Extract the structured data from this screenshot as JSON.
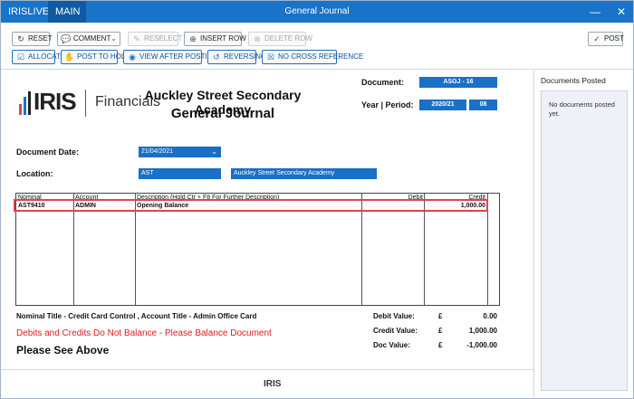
{
  "titlebar": {
    "tabs": [
      "IRISLIVE",
      "MAIN"
    ],
    "title": "General Journal",
    "minimize": "—",
    "close": "✕"
  },
  "toolbar": {
    "reset": "RESET",
    "comment": "COMMENT",
    "reselect": "RESELECT",
    "insert_row": "INSERT ROW",
    "delete_row": "DELETE ROW",
    "post": "POST",
    "allocate": "ALLOCATE",
    "post_to_hold": "POST TO HOLD",
    "view_after_posting": "VIEW AFTER POSTING",
    "reversing": "REVERSING",
    "no_cross_reference": "NO CROSS REFERENCE"
  },
  "header": {
    "logo_text": "IRIS",
    "logo_product": "Financials",
    "school_name": "Auckley Street Secondary Academy",
    "journal_title": "General Journal",
    "document_label": "Document:",
    "document_value": "ASGJ - 16",
    "year_period_label": "Year | Period:",
    "year_value": "2020/21",
    "period_value": "08"
  },
  "form": {
    "document_date_label": "Document Date:",
    "document_date_value": "21/04/2021",
    "location_label": "Location:",
    "location_code": "AST",
    "location_name": "Auckley Street Secondary Academy"
  },
  "grid": {
    "columns": [
      "Nominal",
      "Account",
      "Description (Hold Ctr + F8 For Further Description)",
      "Debit",
      "Credit"
    ],
    "rows": [
      {
        "nominal": "AST9410",
        "account": "ADMIN",
        "description": "Opening Balance",
        "debit": "",
        "credit": "1,000.00"
      }
    ]
  },
  "footer_info": {
    "nominal_title": "Nominal Title - Credit Card Control , Account Title - Admin Office Card",
    "warning": "Debits and Credits Do Not Balance - Please Balance Document",
    "see_above": "Please See Above"
  },
  "totals": {
    "currency": "£",
    "debit_label": "Debit Value:",
    "debit_value": "0.00",
    "credit_label": "Credit Value:",
    "credit_value": "1,000.00",
    "doc_label": "Doc Value:",
    "doc_value": "-1,000.00"
  },
  "footer_logo": "IRIS",
  "right_panel": {
    "title": "Documents Posted",
    "empty_text": "No documents posted yet."
  },
  "colors": {
    "titlebar": "#1a73c6",
    "field_blue": "#1a6fc7",
    "warning_red": "#e01b1b",
    "highlight_red": "#e2424d"
  }
}
